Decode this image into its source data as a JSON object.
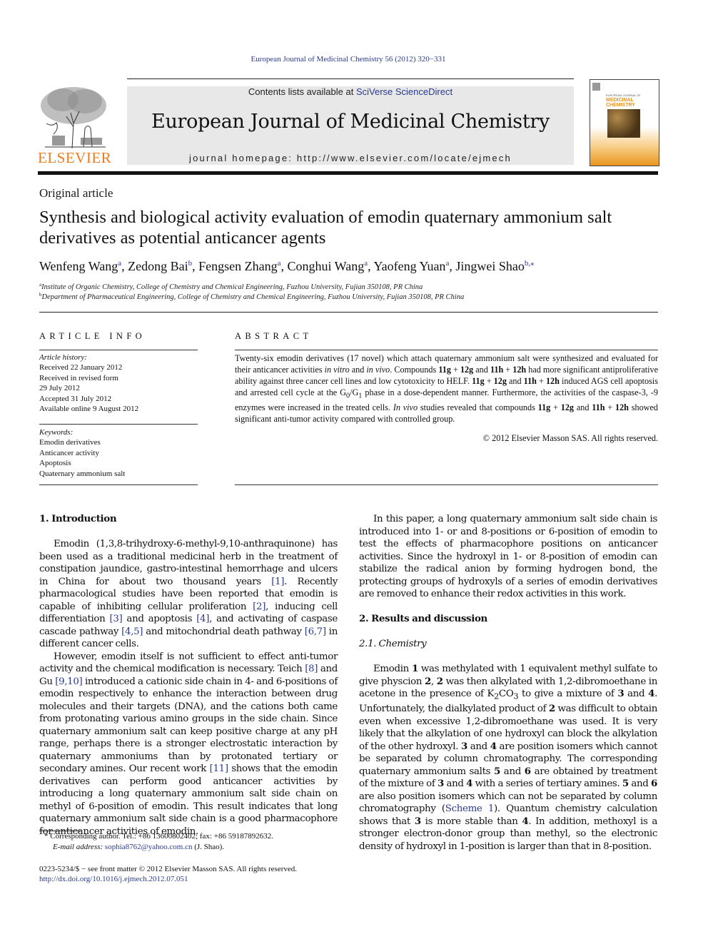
{
  "header": {
    "citation": "European Journal of Medicinal Chemistry 56 (2012) 320−331",
    "publisher_logo_text": "ELSEVIER",
    "contents_prefix": "Contents lists available at ",
    "contents_link": "SciVerse ScienceDirect",
    "journal_title": "European Journal of Medicinal Chemistry",
    "homepage_line": "journal homepage: http://www.elsevier.com/locate/ejmech",
    "cover": {
      "small_text": "EUROPEAN JOURNAL OF",
      "big_text_1": "MEDICINAL",
      "big_text_2": "CHEMISTRY"
    },
    "colors": {
      "elsevier_orange": "#f07b1b",
      "link_blue": "#2a3b8f",
      "banner_gray": "#e8e8e8"
    }
  },
  "article": {
    "type": "Original article",
    "title": "Synthesis and biological activity evaluation of emodin quaternary ammonium salt derivatives as potential anticancer agents",
    "authors": [
      {
        "name": "Wenfeng Wang",
        "affil": "a"
      },
      {
        "name": "Zedong Bai",
        "affil": "b"
      },
      {
        "name": "Fengsen Zhang",
        "affil": "a"
      },
      {
        "name": "Conghui Wang",
        "affil": "a"
      },
      {
        "name": "Yaofeng Yuan",
        "affil": "a"
      },
      {
        "name": "Jingwei Shao",
        "affil": "b,⁎"
      }
    ],
    "affiliations": [
      {
        "key": "a",
        "text": "Institute of Organic Chemistry, College of Chemistry and Chemical Engineering, Fuzhou University, Fujian 350108, PR China"
      },
      {
        "key": "b",
        "text": "Department of Pharmaceutical Engineering, College of Chemistry and Chemical Engineering, Fuzhou University, Fujian 350108, PR China"
      }
    ]
  },
  "article_info": {
    "heading": "ARTICLE INFO",
    "history_label": "Article history:",
    "history": [
      "Received 22 January 2012",
      "Received in revised form",
      "29 July 2012",
      "Accepted 31 July 2012",
      "Available online 9 August 2012"
    ],
    "keywords_label": "Keywords:",
    "keywords": [
      "Emodin derivatives",
      "Anticancer activity",
      "Apoptosis",
      "Quaternary ammonium salt"
    ]
  },
  "abstract": {
    "heading": "ABSTRACT",
    "copyright": "© 2012 Elsevier Masson SAS. All rights reserved."
  },
  "sections": {
    "intro_heading": "1.  Introduction",
    "results_heading": "2.  Results and discussion",
    "chem_heading": "2.1.  Chemistry"
  },
  "footnotes": {
    "corresponding": "* Corresponding author. Tel.: +86 13600802402; fax: +86 59187892632.",
    "email_label": "E-mail address: ",
    "email": "sophia8762@yahoo.com.cn",
    "email_suffix": " (J. Shao).",
    "issn": "0223-5234/$ − see front matter © 2012 Elsevier Masson SAS. All rights reserved.",
    "doi": "http://dx.doi.org/10.1016/j.ejmech.2012.07.051"
  },
  "abstract_html_parts": {
    "t1": "Twenty-six emodin derivatives (17 novel) which attach quaternary ammonium salt were synthesized and evaluated for their anticancer activities ",
    "i1": "in vitro",
    "t2": " and ",
    "i2": "in vivo",
    "t3": ". Compounds ",
    "c1": "11g",
    "p": " + ",
    "c2": "12g",
    "and": " and ",
    "c3": "11h",
    "c4": "12h",
    "t4": " had more significant antiproliferative ability against three cancer cell lines and low cytotoxicity to HELF. ",
    "t5": " induced AGS cell apoptosis and arrested cell cycle at the G",
    "sub0": "0",
    "slash": "/G",
    "sub1": "1",
    "t6": " phase in a dose-dependent manner. Furthermore, the activities of the caspase-3, -9 enzymes were increased in the treated cells. ",
    "i3": "In vivo",
    "t7": " studies revealed that compounds ",
    "t8": " showed significant anti-tumor activity compared with controlled group."
  },
  "body": {
    "intro_p1": {
      "a": "Emodin (1,3,8-trihydroxy-6-methyl-9,10-anthraquinone) has been used as a traditional medicinal herb in the treatment of constipation jaundice, gastro-intestinal hemorrhage and ulcers in China for about two thousand years ",
      "r1": "[1]",
      "b": ". Recently pharmacological studies have been reported that emodin is capable of inhibiting cellular proliferation ",
      "r2": "[2]",
      "c": ", inducing cell differentiation ",
      "r3": "[3]",
      "d": " and apoptosis ",
      "r4": "[4]",
      "e": ", and activating of caspase cascade pathway ",
      "r5": "[4,5]",
      "f": " and mitochondrial death pathway ",
      "r6": "[6,7]",
      "g": " in different cancer cells."
    },
    "intro_p2": {
      "a": "However, emodin itself is not sufficient to effect anti-tumor activity and the chemical modification is necessary. Teich ",
      "r1": "[8]",
      "b": " and Gu ",
      "r2": "[9,10]",
      "c": " introduced a cationic side chain in 4- and 6-positions of emodin respectively to enhance the interaction between drug molecules and their targets (DNA), and the cations both came from protonating various amino groups in the side chain. Since quater­nary ammonium salt can keep positive charge at any pH range, perhaps there is a stronger electrostatic interaction by quaternary ammoniums than by protonated tertiary or secondary amines. Our recent work ",
      "r3": "[11]",
      "d": " shows that the emodin derivatives can perform good anticancer activities by introducing a long quaternary ammonium salt side chain on methyl of 6-position of emodin. This result indicates that long quaternary ammonium salt side chain is a good pharmacophore for anticancer activities of emodin."
    },
    "right_p1": "In this paper, a long quaternary ammonium salt side chain is introduced into 1- or and 8-positions or 6-position of emodin to test the effects of pharmacophore positions on anticancer activities. Since the hydroxyl in 1- or 8-position of emodin can stabilize the radical anion by forming hydrogen bond, the protecting groups of hydroxyls of a series of emodin derivatives are removed to enhance their redox activities in this work.",
    "chem_p1": {
      "a": "Emodin ",
      "n1": "1",
      "b": " was methylated with 1 equivalent methyl sulfate to give physcion ",
      "n2": "2",
      "c": ", ",
      "d": " was then alkylated with 1,2-dibromoethane in acetone in the presence of K",
      "k2": "2",
      "co": "CO",
      "k3": "3",
      "e": " to give a mixture of ",
      "n3": "3",
      "and": " and ",
      "n4": "4",
      "f": ". Unfortunately, the dialkylated product of ",
      "g": " was difficult to obtain even when excessive 1,2-dibromoethane was used. It is very likely that the alkylation of one hydroxyl can block the alkylation of the other hydroxyl. ",
      "h": " are position isomers which cannot be separated by column chromatography. The corresponding quaternary ammonium salts ",
      "n5": "5",
      "n6": "6",
      "i": " are obtained by treatment of the mixture of ",
      "j": " with a series of tertiary amines. ",
      "k": " are also position isomers which can not be separated by column chromatography (",
      "scheme": "Scheme 1",
      "l": "). Quantum chemistry calculation shows that ",
      "m": " is more stable than ",
      "n": ". In addition, methoxyl is a stronger electron-donor group than methyl, so the electronic density of hydroxyl in 1-position is larger than that in 8-position."
    }
  }
}
